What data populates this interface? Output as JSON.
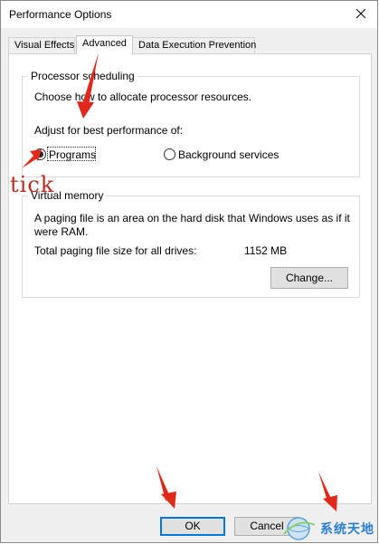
{
  "window": {
    "title": "Performance Options"
  },
  "tabs": [
    {
      "label": "Visual Effects"
    },
    {
      "label": "Advanced"
    },
    {
      "label": "Data Execution Prevention"
    }
  ],
  "processor_scheduling": {
    "legend": "Processor scheduling",
    "description": "Choose how to allocate processor resources.",
    "adjust_label": "Adjust for best performance of:",
    "options": [
      {
        "label": "Programs",
        "selected": true
      },
      {
        "label": "Background services",
        "selected": false
      }
    ]
  },
  "virtual_memory": {
    "legend": "Virtual memory",
    "description_line1": "A paging file is an area on the hard disk that Windows uses as if it",
    "description_line2": "were RAM.",
    "total_label": "Total paging file size for all drives:",
    "total_value": "1152 MB",
    "change_button": "Change..."
  },
  "footer": {
    "ok_button": "OK",
    "cancel_button": "Cancel"
  },
  "annotations": {
    "tick_label": "tick",
    "arrow_color": "#e0281b",
    "watermark_text": "系统天地"
  },
  "colors": {
    "accent": "#0078d7",
    "annotation_red": "#e0281b",
    "watermark_blue": "#2a7fd4"
  }
}
